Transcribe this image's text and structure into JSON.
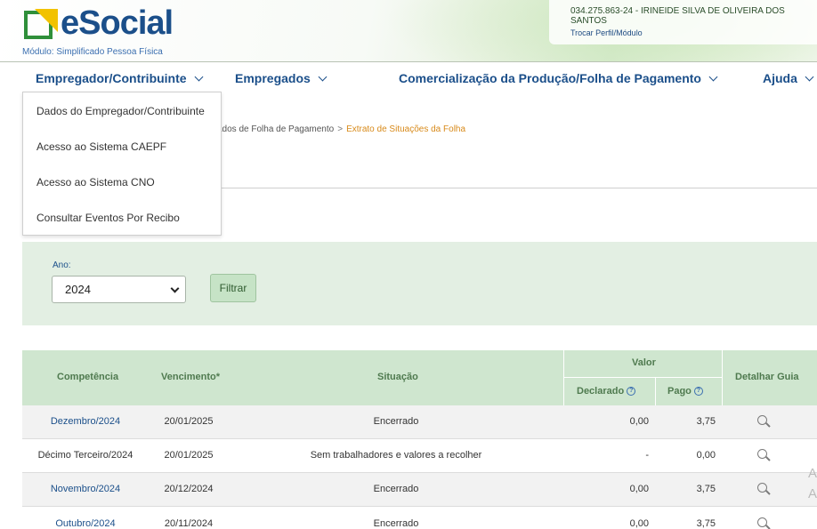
{
  "header": {
    "logo_text": "eSocial",
    "module_label": "Módulo: Simplificado Pessoa Física",
    "user_id": "034.275.863-24 - IRINEIDE SILVA DE OLIVEIRA DOS SANTOS",
    "switch_profile_link": "Trocar Perfil/Módulo"
  },
  "nav": {
    "items": [
      {
        "label": "Empregador/Contribuinte"
      },
      {
        "label": "Empregados"
      },
      {
        "label": "Comercialização da Produção/Folha de Pagamento"
      },
      {
        "label": "Ajuda"
      }
    ]
  },
  "dropdown": {
    "items": [
      {
        "label": "Dados do Empregador/Contribuinte"
      },
      {
        "label": "Acesso ao Sistema CAEPF"
      },
      {
        "label": "Acesso ao Sistema CNO"
      },
      {
        "label": "Consultar Eventos Por Recibo"
      }
    ]
  },
  "breadcrumb": {
    "partial": "ados de Folha de Pagamento",
    "separator": ">",
    "current": "Extrato de Situações da Folha"
  },
  "filter": {
    "year_label": "Ano:",
    "year_value": "2024",
    "button_label": "Filtrar"
  },
  "table": {
    "headers": {
      "competencia": "Competência",
      "vencimento": "Vencimento*",
      "situacao": "Situação",
      "valor": "Valor",
      "declarado": "Declarado",
      "pago": "Pago",
      "detalhar": "Detalhar Guia"
    },
    "help_glyph": "?",
    "rows": [
      {
        "competencia": "Dezembro/2024",
        "vencimento": "20/01/2025",
        "situacao": "Encerrado",
        "declarado": "0,00",
        "pago": "3,75",
        "link": true
      },
      {
        "competencia": "Décimo Terceiro/2024",
        "vencimento": "20/01/2025",
        "situacao": "Sem trabalhadores e valores a recolher",
        "declarado": "-",
        "pago": "0,00",
        "link": false
      },
      {
        "competencia": "Novembro/2024",
        "vencimento": "20/12/2024",
        "situacao": "Encerrado",
        "declarado": "0,00",
        "pago": "3,75",
        "link": true
      },
      {
        "competencia": "Outubro/2024",
        "vencimento": "20/11/2024",
        "situacao": "Encerrado",
        "declarado": "0,00",
        "pago": "3,75",
        "link": true
      }
    ]
  },
  "edge_letters": [
    "A",
    "A"
  ],
  "colors": {
    "brand_blue": "#1b4f8a",
    "accent_orange": "#d88a1a",
    "header_green": "#cfe6cf",
    "panel_green": "#e3efe3"
  }
}
